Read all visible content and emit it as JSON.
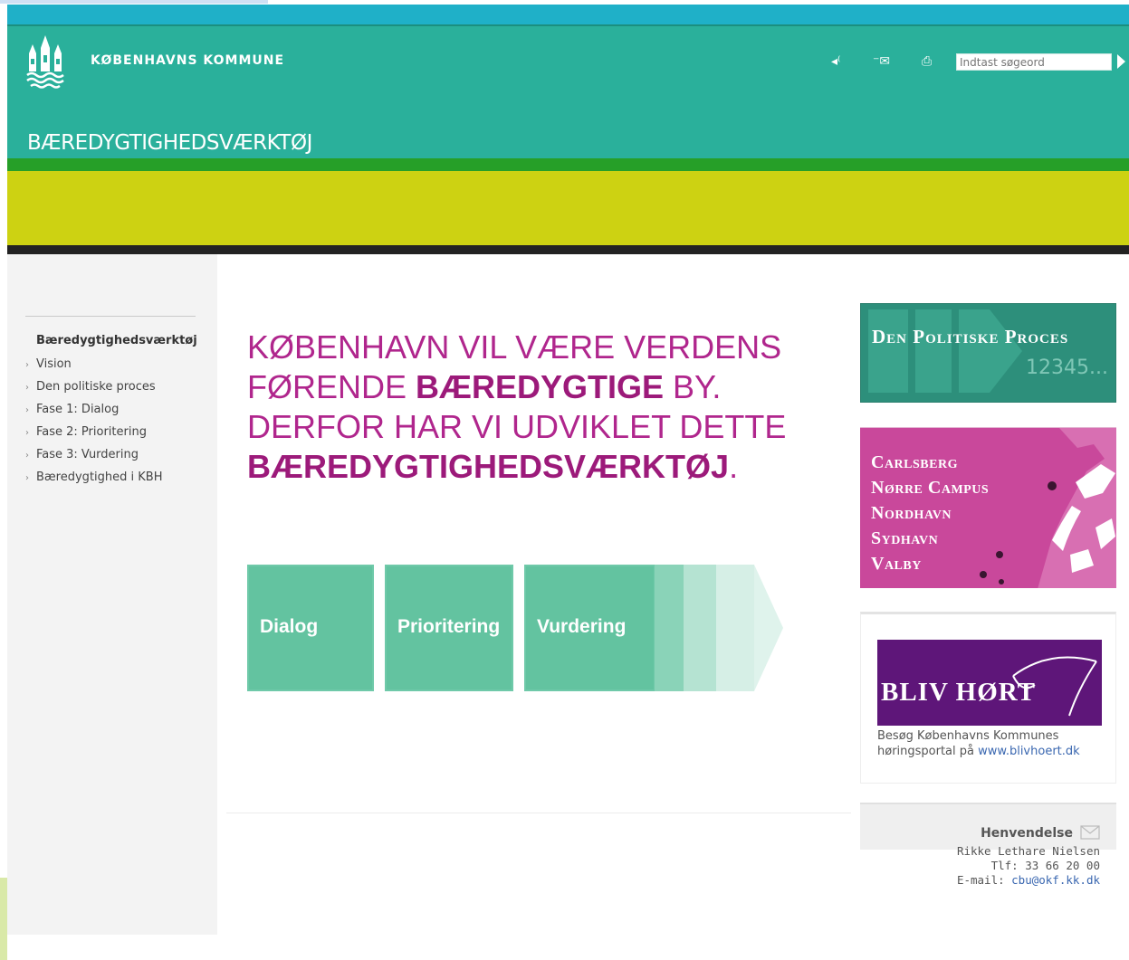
{
  "header": {
    "org_name": "KØBENHAVNS KOMMUNE",
    "site_title": "BÆREDYGTIGHEDSVÆRKTØJ",
    "search_placeholder": "Indtast søgeord",
    "colors": {
      "teal": "#2ab09b",
      "green": "#269f28",
      "yellow": "#cdd212",
      "cyan": "#1fb0c8"
    }
  },
  "sidebar": {
    "title": "Bæredygtighedsværktøj",
    "items": [
      {
        "label": "Vision"
      },
      {
        "label": "Den politiske proces"
      },
      {
        "label": "Fase 1: Dialog"
      },
      {
        "label": "Fase 2: Prioritering"
      },
      {
        "label": "Fase 3: Vurdering"
      },
      {
        "label": "Bæredygtighed i KBH"
      }
    ]
  },
  "main": {
    "headline_line1": "KØBENHAVN VIL VÆRE VERDENS",
    "headline_line2_pre": "FØRENDE ",
    "headline_line2_bold": "BÆREDYGTIGE",
    "headline_line2_post": " BY.",
    "headline_line3": "DERFOR HAR VI UDVIKLET DETTE",
    "headline_line4_bold": "BÆREDYGTIGHEDSVÆRKTØJ",
    "headline_line4_post": ".",
    "steps": [
      {
        "label": "Dialog"
      },
      {
        "label": "Prioritering"
      },
      {
        "label": "Vurdering"
      }
    ]
  },
  "right": {
    "political": {
      "title": "Den Politiske Proces",
      "digits": "12345..."
    },
    "areas": [
      "Carlsberg",
      "Nørre  Campus",
      "Nordhavn",
      "Sydhavn",
      "Valby"
    ],
    "hearing": {
      "banner_text": "BLIV HØRT",
      "text_pre": "Besøg Københavns Kommunes høringsportal på ",
      "link": "www.blivhoert.dk"
    },
    "contact": {
      "heading": "Henvendelse",
      "name": "Rikke Lethare Nielsen",
      "phone": "Tlf: 33 66 20 00",
      "email_label": "E-mail: ",
      "email": "cbu@okf.kk.dk"
    }
  }
}
